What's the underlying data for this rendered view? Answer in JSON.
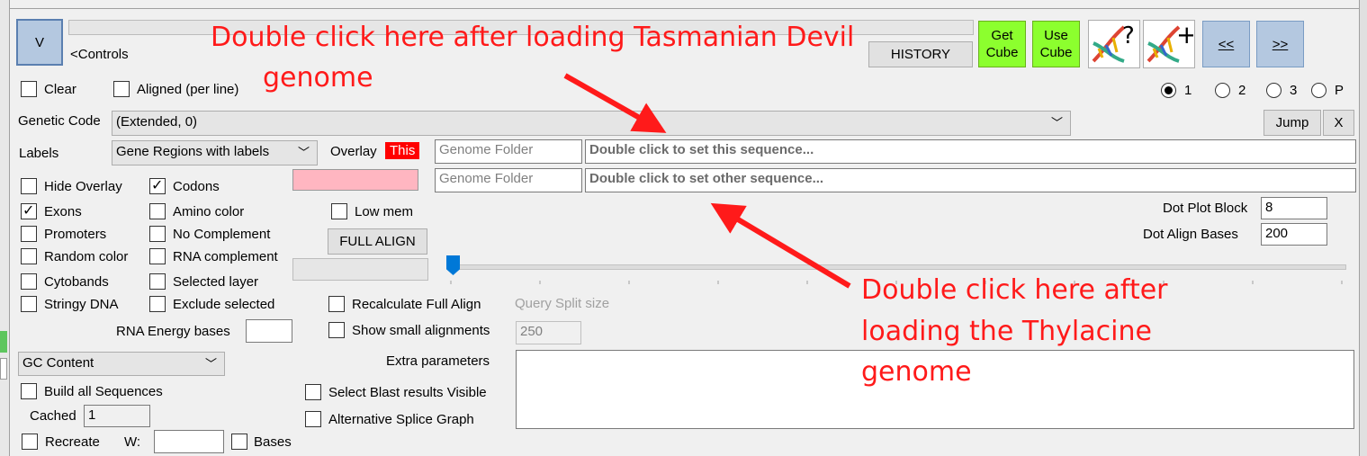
{
  "controls": {
    "toggle_label": "V",
    "controls_label": "<Controls",
    "history": "HISTORY",
    "get_cube": [
      "Get",
      "Cube"
    ],
    "use_cube": [
      "Use",
      "Cube"
    ],
    "prev": "<<",
    "next": ">>"
  },
  "radios": [
    "1",
    "2",
    "3",
    "P"
  ],
  "clear": "Clear",
  "aligned": "Aligned (per line)",
  "genetic_code_label": "Genetic Code",
  "genetic_code_value": "(Extended, 0)",
  "jump": "Jump",
  "x": "X",
  "labels_label": "Labels",
  "labels_value": "Gene Regions with labels",
  "overlay_label": "Overlay",
  "this_badge": "This",
  "genome_folder_1": "Genome Folder",
  "seq_this": "Double click to set this sequence...",
  "genome_folder_2": "Genome Folder",
  "seq_other": "Double click to set other sequence...",
  "checkboxes_col1": [
    {
      "label": "Hide Overlay",
      "checked": false
    },
    {
      "label": "Exons",
      "checked": true
    },
    {
      "label": "Promoters",
      "checked": false
    },
    {
      "label": "Random color",
      "checked": false
    },
    {
      "label": "Cytobands",
      "checked": false
    },
    {
      "label": "Stringy DNA",
      "checked": false
    }
  ],
  "checkboxes_col2": [
    {
      "label": "Codons",
      "checked": true
    },
    {
      "label": "Amino color",
      "checked": false
    },
    {
      "label": "No Complement",
      "checked": false
    },
    {
      "label": "RNA complement",
      "checked": false
    },
    {
      "label": "Selected layer",
      "checked": false
    },
    {
      "label": "Exclude selected",
      "checked": false
    }
  ],
  "low_mem": "Low mem",
  "full_align": "FULL ALIGN",
  "dot_plot_block_label": "Dot Plot Block",
  "dot_plot_block_value": "8",
  "dot_align_bases_label": "Dot Align Bases",
  "dot_align_bases_value": "200",
  "recalc": "Recalculate Full Align",
  "query_split_label": "Query Split size",
  "query_split_value": "250",
  "show_small": "Show small alignments",
  "rna_energy_label": "RNA Energy bases",
  "gc_content": "GC Content",
  "extra_params": "Extra parameters",
  "build_all": "Build all Sequences",
  "select_blast": "Select Blast results Visible",
  "cached_label": "Cached",
  "cached_value": "1",
  "alt_splice": "Alternative Splice Graph",
  "recreate": "Recreate",
  "w_label": "W:",
  "bases": "Bases",
  "annotation_top": [
    "Double click here after loading Tasmanian Devil",
    "genome"
  ],
  "annotation_bottom": [
    "Double click here after",
    "loading the Thylacine",
    "genome"
  ],
  "colors": {
    "accent_red": "#ff1a1a",
    "green": "#8cff2e",
    "pink": "#ffb6c1",
    "blue_btn": "#b4c8e0"
  }
}
